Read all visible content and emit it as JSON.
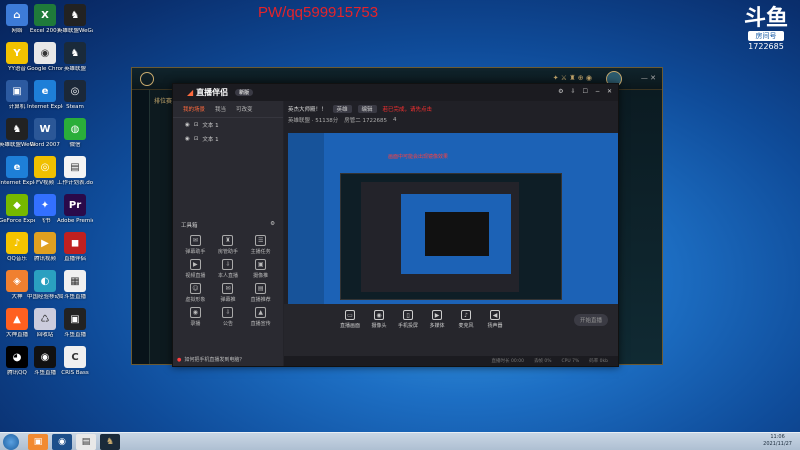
{
  "watermark": "PW/qq599915753",
  "douyu": {
    "glyph": "斗鱼",
    "room_label": "房间号",
    "room_id": "1722685"
  },
  "desktop_icons": [
    {
      "label": "网络",
      "color": "#3d7bd8",
      "glyph": "⌂"
    },
    {
      "label": "Excel 2007",
      "color": "#1f7a3a",
      "glyph": "X"
    },
    {
      "label": "英雄联盟WeGame版",
      "color": "#222",
      "glyph": "♞"
    },
    {
      "label": "YY语音",
      "color": "#f2c200",
      "glyph": "Y"
    },
    {
      "label": "Google Chrome",
      "color": "#e8e8e8",
      "glyph": "◉"
    },
    {
      "label": "英雄联盟",
      "color": "#1a2a3a",
      "glyph": "♞"
    },
    {
      "label": "计算机",
      "color": "#2c5aa0",
      "glyph": "▣"
    },
    {
      "label": "Internet Explorer",
      "color": "#1e7fd8",
      "glyph": "e"
    },
    {
      "label": "Steam",
      "color": "#1b2838",
      "glyph": "◎"
    },
    {
      "label": "英雄联盟WeGame版",
      "color": "#222",
      "glyph": "♞"
    },
    {
      "label": "Word 2007",
      "color": "#2b5797",
      "glyph": "W"
    },
    {
      "label": "微信",
      "color": "#2aae3a",
      "glyph": "◍"
    },
    {
      "label": "Internet Explorer",
      "color": "#1e7fd8",
      "glyph": "e"
    },
    {
      "label": "FV视频",
      "color": "#f0c000",
      "glyph": "◎"
    },
    {
      "label": "工作计划表.docx",
      "color": "#f4f4f4",
      "glyph": "▤"
    },
    {
      "label": "GeForce Experience",
      "color": "#76b900",
      "glyph": "◆"
    },
    {
      "label": "飞书",
      "color": "#3370ff",
      "glyph": "✦"
    },
    {
      "label": "Adobe Premiere",
      "color": "#2a0a4a",
      "glyph": "Pr"
    },
    {
      "label": "QQ音乐",
      "color": "#f5c400",
      "glyph": "♪"
    },
    {
      "label": "腾讯视频",
      "color": "#e0a020",
      "glyph": "▶"
    },
    {
      "label": "直播伴侣",
      "color": "#c02020",
      "glyph": "◼"
    },
    {
      "label": "大神",
      "color": "#f08030",
      "glyph": "◈"
    },
    {
      "label": "中国经验移动端",
      "color": "#2aa0c0",
      "glyph": "◐"
    },
    {
      "label": "斗鱼直播",
      "color": "#f0f0f0",
      "glyph": "▦"
    },
    {
      "label": "大神直播",
      "color": "#ff6020",
      "glyph": "▲"
    },
    {
      "label": "回收站",
      "color": "#ccd",
      "glyph": "♺"
    },
    {
      "label": "斗鱼直播",
      "color": "#222",
      "glyph": "▣"
    },
    {
      "label": "腾讯QQ",
      "color": "#000",
      "glyph": "◕"
    },
    {
      "label": "斗鱼直播",
      "color": "#111",
      "glyph": "◉"
    },
    {
      "label": "CRIS Bass",
      "color": "#f0f0f0",
      "glyph": "C"
    }
  ],
  "lol": {
    "nav": "排位赛"
  },
  "app": {
    "brand": "直播伴侣",
    "version": "新版",
    "header_controls": [
      "⚙",
      "⇩",
      "☐",
      "−",
      "✕"
    ],
    "left_tabs": [
      "我的场景",
      "我当",
      "可改变"
    ],
    "scenes": [
      "文本 1",
      "文本 1"
    ],
    "tools_title": "工具箱",
    "tools": [
      "弹幕助手",
      "房管助手",
      "主播任务",
      "视频直播",
      "本人直播",
      "摄像推",
      "虚拟形象",
      "弹幕推",
      "直播推荐",
      "录播",
      "公告",
      "直播宣传"
    ],
    "left_hint": "如何把手机直播发到电脑？",
    "room_title": "英杰大师殿！！",
    "room_tag": "英雄",
    "room_edit": "编辑",
    "room_red": "若已完成，请先点击",
    "room_stats": [
      "英雄联盟 · 51138分",
      "房管二 1722685",
      "4"
    ],
    "preview_notice": "画面中可能会出现镜像效果",
    "buttons": [
      "直播画面",
      "摄像头",
      "手机投屏",
      "多媒体",
      "麦克风",
      "扬声器"
    ],
    "start": "开始直播",
    "status": [
      "直播时长 00:00",
      "丢帧 0%",
      "CPU 7%",
      "码率 0kb"
    ]
  },
  "taskbar": {
    "time": "11:06",
    "date": "2021/11/27"
  }
}
